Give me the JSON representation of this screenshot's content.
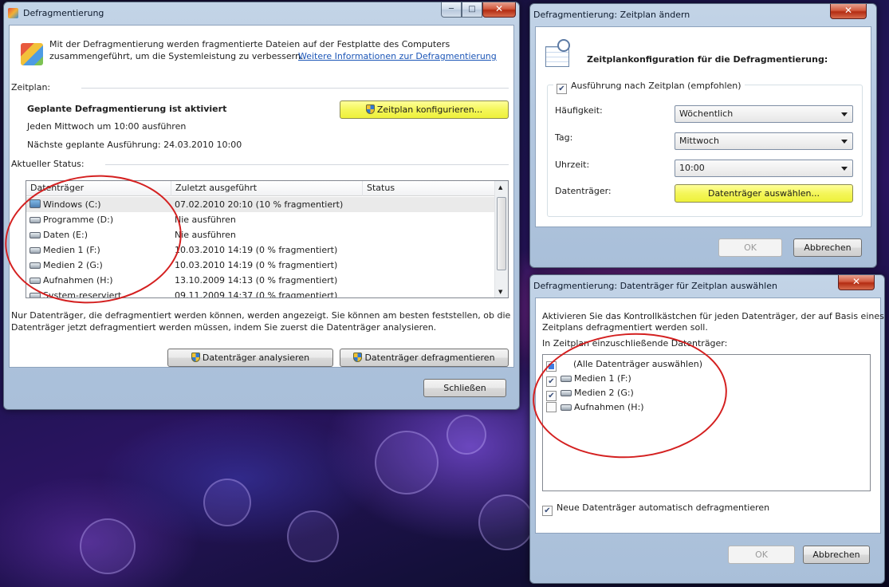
{
  "main": {
    "title": "Defragmentierung",
    "intro_line1": "Mit der Defragmentierung werden fragmentierte Dateien auf der Festplatte des Computers",
    "intro_line2": "zusammengeführt, um die Systemleistung zu verbessern.",
    "intro_link": "Weitere Informationen zur Defragmentierung",
    "schedule_heading": "Zeitplan:",
    "schedule_status": "Geplante Defragmentierung ist aktiviert",
    "schedule_run": "Jeden Mittwoch um 10:00 ausführen",
    "next_run": "Nächste geplante Ausführung: 24.03.2010 10:00",
    "configure_button": "Zeitplan konfigurieren...",
    "current_status_heading": "Aktueller Status:",
    "columns": [
      "Datenträger",
      "Zuletzt ausgeführt",
      "Status"
    ],
    "rows": [
      {
        "drive": "Windows (C:)",
        "last": "07.02.2010 20:10 (10 % fragmentiert)",
        "status": ""
      },
      {
        "drive": "Programme (D:)",
        "last": "Nie ausführen",
        "status": ""
      },
      {
        "drive": "Daten (E:)",
        "last": "Nie ausführen",
        "status": ""
      },
      {
        "drive": "Medien 1 (F:)",
        "last": "10.03.2010 14:19 (0 % fragmentiert)",
        "status": ""
      },
      {
        "drive": "Medien 2 (G:)",
        "last": "10.03.2010 14:19 (0 % fragmentiert)",
        "status": ""
      },
      {
        "drive": "Aufnahmen (H:)",
        "last": "13.10.2009 14:13 (0 % fragmentiert)",
        "status": ""
      },
      {
        "drive": "System-reserviert",
        "last": "09.11.2009 14:37 (0 % fragmentiert)",
        "status": ""
      }
    ],
    "note_line1": "Nur Datenträger, die defragmentiert werden können, werden angezeigt. Sie können am besten feststellen, ob die",
    "note_line2": "Datenträger jetzt defragmentiert werden müssen, indem Sie zuerst die Datenträger analysieren.",
    "analyze_button": "Datenträger analysieren",
    "defrag_button": "Datenträger defragmentieren",
    "close_button": "Schließen"
  },
  "schedule_dialog": {
    "title": "Defragmentierung: Zeitplan ändern",
    "heading": "Zeitplankonfiguration für die Defragmentierung:",
    "run_on_schedule": "Ausführung nach Zeitplan (empfohlen)",
    "run_on_schedule_checked": true,
    "frequency_label": "Häufigkeit:",
    "frequency_value": "Wöchentlich",
    "day_label": "Tag:",
    "day_value": "Mittwoch",
    "time_label": "Uhrzeit:",
    "time_value": "10:00",
    "disks_label": "Datenträger:",
    "select_disks_button": "Datenträger auswählen...",
    "ok_button": "OK",
    "cancel_button": "Abbrechen"
  },
  "disk_dialog": {
    "title": "Defragmentierung: Datenträger für Zeitplan auswählen",
    "desc_line1": "Aktivieren Sie das Kontrollkästchen für jeden Datenträger, der auf Basis eines",
    "desc_line2": "Zeitplans defragmentiert werden soll.",
    "list_label": "In Zeitplan einzuschließende Datenträger:",
    "items": [
      {
        "label": "(Alle Datenträger auswählen)",
        "state": "partial"
      },
      {
        "label": "Medien 1 (F:)",
        "state": "checked"
      },
      {
        "label": "Medien 2 (G:)",
        "state": "checked"
      },
      {
        "label": "Aufnahmen (H:)",
        "state": "unchecked"
      }
    ],
    "auto_new": "Neue Datenträger automatisch defragmentieren",
    "auto_new_checked": true,
    "ok_button": "OK",
    "cancel_button": "Abbrechen"
  },
  "colors": {
    "highlight": "#f4f65a",
    "annotation": "#d42020",
    "link": "#1c56b7"
  }
}
